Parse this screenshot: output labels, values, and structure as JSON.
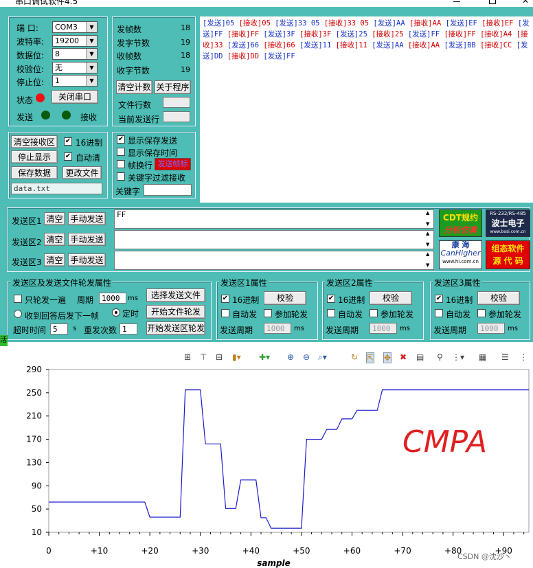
{
  "app": {
    "title": "串口调试软件4.5"
  },
  "port": {
    "port_label": "端 口:",
    "port_value": "COM3",
    "baud_label": "波特率:",
    "baud_value": "19200",
    "data_label": "数据位:",
    "data_value": "8",
    "parity_label": "校验位:",
    "parity_value": "无",
    "stop_label": "停止位:",
    "stop_value": "1",
    "status_label": "状态",
    "close_btn": "关闭串口",
    "send_label": "发送",
    "recv_label": "接收",
    "status_color": "#ee1111",
    "led_color": "#0d5a0d"
  },
  "stats": {
    "frames_label": "发帧数",
    "frames_value": "18",
    "bytes_sent_label": "发字节数",
    "bytes_sent_value": "19",
    "frames_recv_label": "收帧数",
    "frames_recv_value": "18",
    "bytes_recv_label": "收字节数",
    "bytes_recv_value": "19",
    "clear_btn": "清空计数",
    "about_btn": "关于程序",
    "file_lines_label": "文件行数",
    "current_line_label": "当前发送行"
  },
  "recv": {
    "clear_btn": "清空接收区",
    "hex_label": "16进制",
    "hex": true,
    "stop_btn": "停止显示",
    "auto_clear_label": "自动清",
    "auto_clear": true,
    "save_btn": "保存数据",
    "change_file_btn": "更改文件",
    "filename": "data.txt"
  },
  "display": {
    "show_save_send": "显示保存发送",
    "show_save_send_on": true,
    "show_save_time": "显示保存时间",
    "frame_wrap": "帧换行",
    "key_filter": "关键字过滤接收",
    "keyword_label": "关键字",
    "red_box": "发送帧标"
  },
  "log": [
    {
      "d": "tx",
      "t": "[发送]05 "
    },
    {
      "d": "rx",
      "t": "[接收]05 "
    },
    {
      "d": "tx",
      "t": "[发送]33 05 "
    },
    {
      "d": "rx",
      "t": "[接收]33 05 "
    },
    {
      "d": "tx",
      "t": "[发送]AA "
    },
    {
      "d": "rx",
      "t": "[接收]AA "
    },
    {
      "d": "tx",
      "t": "[发送]EF "
    },
    {
      "d": "rx",
      "t": "[接收]EF "
    },
    {
      "d": "tx",
      "t": "[发送]FF "
    },
    {
      "d": "rx",
      "t": "[接收]FF "
    },
    {
      "d": "tx",
      "t": "[发送]3F "
    },
    {
      "d": "rx",
      "t": "[接收]3F "
    },
    {
      "d": "tx",
      "t": "[发送]25 "
    },
    {
      "d": "rx",
      "t": "[接收]25 "
    },
    {
      "d": "tx",
      "t": "[发送]FF "
    },
    {
      "d": "rx",
      "t": "[接收]FF "
    },
    {
      "d": "rx",
      "t": "[接收]A4 "
    },
    {
      "d": "rx",
      "t": "[接收]33 "
    },
    {
      "d": "tx",
      "t": "[发送]66 "
    },
    {
      "d": "rx",
      "t": "[接收]66 "
    },
    {
      "d": "tx",
      "t": "[发送]11 "
    },
    {
      "d": "rx",
      "t": "[接收]11 "
    },
    {
      "d": "tx",
      "t": "[发送]AA "
    },
    {
      "d": "rx",
      "t": "[接收]AA "
    },
    {
      "d": "tx",
      "t": "[发送]BB "
    },
    {
      "d": "rx",
      "t": "[接收]CC "
    },
    {
      "d": "tx",
      "t": "[发送]DD "
    },
    {
      "d": "rx",
      "t": "[接收]DD "
    },
    {
      "d": "tx",
      "t": "[发送]FF"
    }
  ],
  "send": {
    "area1_label": "发送区1",
    "area2_label": "发送区2",
    "area3_label": "发送区3",
    "clear_btn": "清空",
    "manual_btn": "手动发送",
    "area1_value": "FF"
  },
  "ads": {
    "cdt_line1": "CDT规约",
    "cdt_line2": "分析仿真",
    "bosi_top": "RS-232/RS-485",
    "bosi_main": "波士电子",
    "bosi_url": "www.bosi.com.cn",
    "canhigher_cn": "康 海",
    "canhigher_en": "CanHigher",
    "canhigher_url": "www.hi.com.cn",
    "config_line1": "组态软件",
    "config_line2": "源 代 码"
  },
  "rotation": {
    "title": "发送区及发送文件轮发属性",
    "once": "只轮发一遍",
    "period_label": "周期",
    "period_value": "1000",
    "ms": "ms",
    "select_file_btn": "选择发送文件",
    "reply_next": "收到回答后发下一帧",
    "timed": "定时",
    "start_file_btn": "开始文件轮发",
    "timeout_label": "超时时间",
    "timeout_value": "5",
    "s": "s",
    "retry_label": "重发次数",
    "retry_value": "1",
    "start_area_btn": "开始发送区轮发"
  },
  "areas": [
    {
      "title": "发送区1属性",
      "hex": "16进制",
      "check_btn": "校验",
      "auto": "自动发",
      "join": "参加轮发",
      "period_label": "发送周期",
      "period_value": "1000",
      "ms": "ms"
    },
    {
      "title": "发送区2属性",
      "hex": "16进制",
      "check_btn": "校验",
      "auto": "自动发",
      "join": "参加轮发",
      "period_label": "发送周期",
      "period_value": "1000",
      "ms": "ms"
    },
    {
      "title": "发送区3属性",
      "hex": "16进制",
      "check_btn": "校验",
      "auto": "自动发",
      "join": "参加轮发",
      "period_label": "发送周期",
      "period_value": "1000",
      "ms": "ms"
    }
  ],
  "side_label": "活",
  "chart_data": {
    "type": "line",
    "xlabel": "sample",
    "ylim": [
      10,
      290
    ],
    "xlim": [
      0,
      95
    ],
    "yticks": [
      "290",
      "250",
      "210",
      "170",
      "130",
      "90",
      "50",
      "10"
    ],
    "xticks": [
      "0",
      "+10",
      "+20",
      "+30",
      "+40",
      "+50",
      "+60",
      "+70",
      "+80",
      "+90"
    ],
    "series_color": "#1a1acc",
    "points": [
      [
        0,
        62
      ],
      [
        19,
        62
      ],
      [
        20,
        36
      ],
      [
        26,
        36
      ],
      [
        27,
        255
      ],
      [
        30,
        255
      ],
      [
        31,
        162
      ],
      [
        34,
        162
      ],
      [
        35,
        51
      ],
      [
        37,
        51
      ],
      [
        38,
        100
      ],
      [
        41,
        100
      ],
      [
        42,
        35
      ],
      [
        43,
        35
      ],
      [
        44,
        17
      ],
      [
        50,
        17
      ],
      [
        51,
        170
      ],
      [
        54,
        170
      ],
      [
        55,
        187
      ],
      [
        57,
        187
      ],
      [
        58,
        205
      ],
      [
        60,
        205
      ],
      [
        61,
        220
      ],
      [
        65,
        220
      ],
      [
        66,
        255
      ],
      [
        95,
        255
      ]
    ],
    "annotation": "CMPA",
    "annotation_color": "#e02020"
  },
  "watermark": "CSDN @沈沙丶"
}
